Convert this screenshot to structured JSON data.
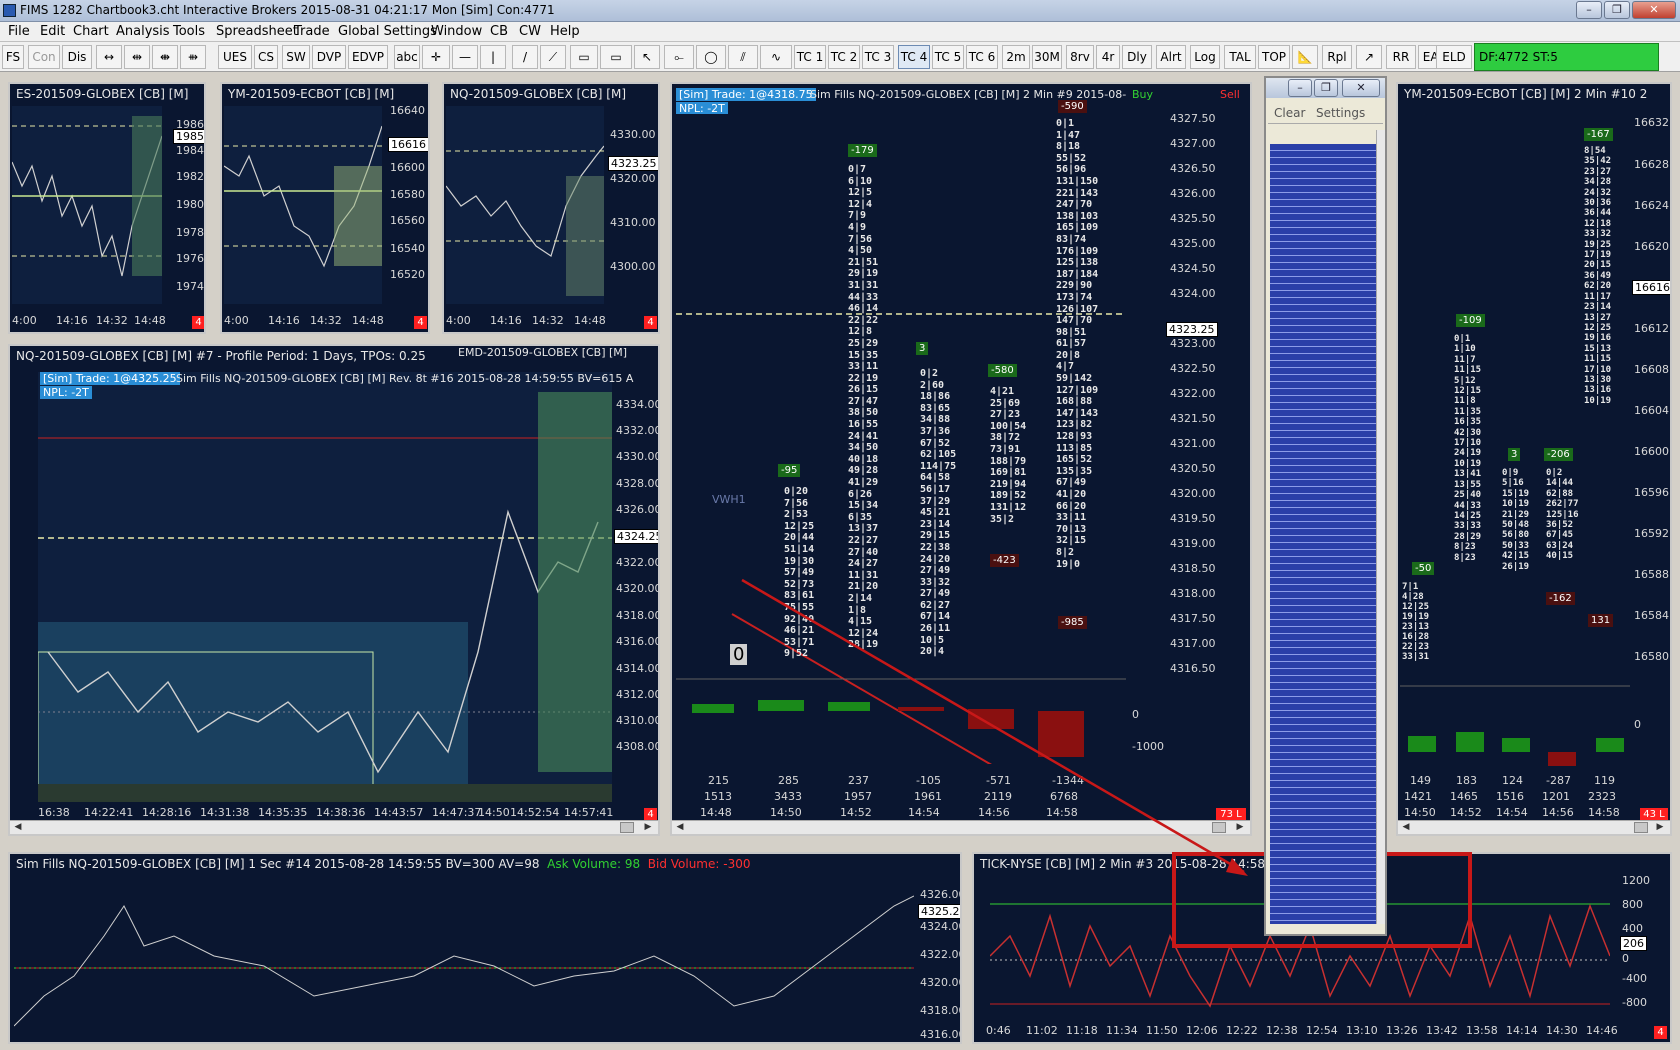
{
  "window": {
    "title": "FIMS 1282 Chartbook3.cht  Interactive Brokers 2015-08-31  04:21:17 Mon [Sim]  Con:4771"
  },
  "menu": [
    "File",
    "Edit",
    "Chart",
    "Analysis",
    "Tools",
    "Spreadsheet",
    "Trade",
    "Global Settings",
    "Window",
    "CB",
    "CW",
    "Help"
  ],
  "toolbar": {
    "buttons": [
      "FS",
      "Con",
      "Dis",
      "UES",
      "CS",
      "SW",
      "DVP",
      "EDVP",
      "abc",
      "TC 1",
      "TC 2",
      "TC 3",
      "TC 4",
      "TC 5",
      "TC 6",
      "2m",
      "30M",
      "8rv",
      "4r",
      "Dly",
      "Alrt",
      "Log",
      "TAL",
      "TOP",
      "Rpl",
      "RR",
      "EAL",
      "ELD"
    ],
    "status": "DF:4772  ST:5"
  },
  "charts": {
    "es": {
      "title": "ES-201509-GLOBEX [CB] [M]",
      "prices": [
        "1986",
        "1985",
        "1984",
        "1982",
        "1980",
        "1978",
        "1976",
        "1974"
      ],
      "times": [
        "4:00",
        "14:16",
        "14:32",
        "14:48"
      ],
      "badge": "4",
      "price_box": "1985"
    },
    "ym": {
      "title": "YM-201509-ECBOT [CB] [M]",
      "prices": [
        "16640",
        "16616",
        "16600",
        "16580",
        "16560",
        "16540",
        "16520"
      ],
      "times": [
        "4:00",
        "14:16",
        "14:32",
        "14:48"
      ],
      "badge": "4",
      "price_box": "16616"
    },
    "nq": {
      "title": "NQ-201509-GLOBEX [CB] [M]",
      "prices": [
        "4330.00",
        "4323.25",
        "4320.00",
        "4310.00",
        "4300.00"
      ],
      "times": [
        "4:00",
        "14:16",
        "14:32",
        "14:48"
      ],
      "badge": "4",
      "price_box": "4323.25"
    },
    "nqprofile": {
      "title": "NQ-201509-GLOBEX [CB] [M] #7 - Profile Period: 1 Days, TPOs: 0.25",
      "trade": "[Sim]  Trade: 1@4325.25",
      "npl": "NPL: -2T",
      "sub": "Sim Fills  NQ-201509-GLOBEX [CB] [M] Rev. 8t  #16 2015-08-28 14:59:55 BV=615 A",
      "prices": [
        "4334.00",
        "4332.00",
        "4330.00",
        "4328.00",
        "4326.00",
        "4324.25",
        "4322.00",
        "4320.00",
        "4318.00",
        "4316.00",
        "4314.00",
        "4312.00",
        "4310.00",
        "4308.00"
      ],
      "times": [
        "16:38",
        "14:22:41",
        "14:28:16",
        "14:31:38",
        "14:35:35",
        "14:38:36",
        "14:43:57",
        "14:47:37",
        "14:50",
        "14:52:54",
        "14:57:41"
      ],
      "badge": "4",
      "price_box": "4324.25"
    },
    "emd": {
      "title": "EMD-201509-GLOBEX [CB] [M]"
    },
    "footprint": {
      "title": "Sim Fills  NQ-201509-GLOBEX [CB] [M]  2 Min   #9 2015-08-",
      "trade": "[Sim]  Trade: 1@4318.75",
      "npl": "NPL: -2T",
      "buy": "Buy",
      "sell": "Sell",
      "prices": [
        "4327.50",
        "4327.00",
        "4326.50",
        "4326.00",
        "4325.50",
        "4325.00",
        "4324.50",
        "4324.00",
        "4323.25",
        "4323.00",
        "4322.50",
        "4322.00",
        "4321.50",
        "4321.00",
        "4320.50",
        "4320.00",
        "4319.50",
        "4319.00",
        "4318.50",
        "4318.00",
        "4317.50",
        "4317.00",
        "4316.50"
      ],
      "price_box": "4323.25",
      "deltas": [
        "-95",
        "-179",
        "3",
        "-580",
        "-423",
        "-590",
        "-985"
      ],
      "vol_top": [
        "215",
        "285",
        "237",
        "-105",
        "-571",
        "-1344"
      ],
      "vol_bot": [
        "1513",
        "3433",
        "1957",
        "1961",
        "2119",
        "6768"
      ],
      "times": [
        "14:48",
        "14:50",
        "14:52",
        "14:54",
        "14:56",
        "14:58"
      ],
      "vwh": "VWH1",
      "zero": "0",
      "hist_axis": [
        "0",
        "-1000"
      ],
      "badge": "73 L"
    },
    "ym2": {
      "title": "YM-201509-ECBOT [CB] [M]  2 Min   #10 2",
      "prices": [
        "16632",
        "16628",
        "16624",
        "16620",
        "16616",
        "16612",
        "16608",
        "16604",
        "16600",
        "16596",
        "16592",
        "16588",
        "16584",
        "16580"
      ],
      "price_box": "16616",
      "deltas": [
        "-50",
        "-109",
        "3",
        "-206",
        "-167",
        "-162",
        "131"
      ],
      "vol_top": [
        "149",
        "183",
        "124",
        "-287",
        "119"
      ],
      "vol_bot": [
        "1421",
        "1465",
        "1516",
        "1201",
        "2323"
      ],
      "times": [
        "14:50",
        "14:52",
        "14:54",
        "14:56",
        "14:58"
      ],
      "hist_axis": [
        "0"
      ],
      "badge": "43 L"
    },
    "simfills": {
      "title": "Sim Fills  NQ-201509-GLOBEX [CB] [M]  1 Sec   #14 2015-08-28 14:59:55 BV=300 AV=98",
      "ask": "Ask Volume: 98",
      "bid": "Bid Volume: -300",
      "prices": [
        "4326.00",
        "4325.25",
        "4324.00",
        "4322.00",
        "4320.00",
        "4318.00",
        "4316.00"
      ],
      "price_box": "4325.25"
    },
    "tick": {
      "title": "TICK-NYSE [CB] [M]  2 Min   #3 2015-08-28 14:58:00",
      "prices": [
        "1200",
        "800",
        "400",
        "206",
        "0",
        "-400",
        "-800"
      ],
      "price_box": "206",
      "times": [
        "0:46",
        "11:02",
        "11:18",
        "11:34",
        "11:50",
        "12:06",
        "12:22",
        "12:38",
        "12:54",
        "13:10",
        "13:26",
        "13:42",
        "13:58",
        "14:14",
        "14:30",
        "14:46"
      ],
      "badge": "4"
    }
  },
  "ts_window": {
    "clear": "Clear",
    "settings": "Settings"
  },
  "colors": {
    "bg": "#0a1630",
    "up": "#32d232",
    "down": "#ff3030",
    "grid": "#1c3560",
    "accent": "#2a8ed6"
  }
}
